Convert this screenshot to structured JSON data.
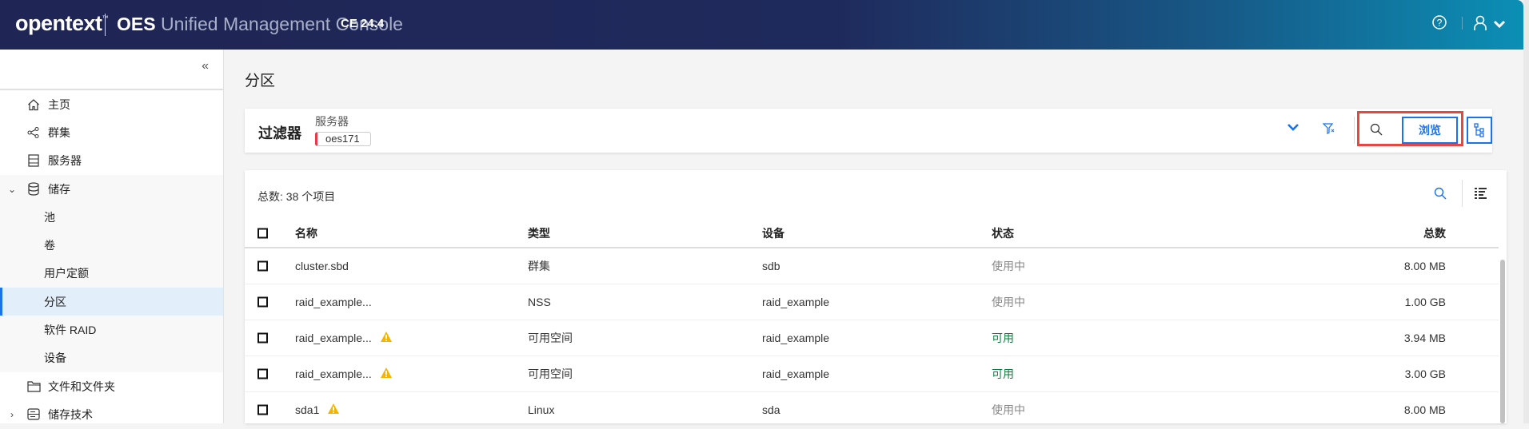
{
  "header": {
    "logo": "opentext",
    "logo_tm": "™",
    "product": "OES",
    "app": "Unified Management Console",
    "version": "CE 24.4"
  },
  "sidebar": {
    "collapse": "«",
    "items": [
      {
        "label": "主页",
        "icon": "home-icon"
      },
      {
        "label": "群集",
        "icon": "share-icon"
      },
      {
        "label": "服务器",
        "icon": "server-icon"
      },
      {
        "label": "储存",
        "icon": "database-icon",
        "expanded": true
      },
      {
        "label": "池"
      },
      {
        "label": "卷"
      },
      {
        "label": "用户定额"
      },
      {
        "label": "分区",
        "active": true
      },
      {
        "label": "软件 RAID"
      },
      {
        "label": "设备"
      },
      {
        "label": "文件和文件夹",
        "icon": "folder-icon"
      },
      {
        "label": "储存技术",
        "icon": "storage-icon"
      }
    ]
  },
  "page": {
    "title": "分区"
  },
  "filter": {
    "title": "过滤器",
    "server_label": "服务器",
    "server_value": "oes171",
    "browse": "浏览"
  },
  "table": {
    "total": "总数: 38 个项目",
    "columns": [
      "名称",
      "类型",
      "设备",
      "状态",
      "总数"
    ],
    "rows": [
      {
        "name": "cluster.sbd",
        "warn": false,
        "type": "群集",
        "device": "sdb",
        "status": "使用中",
        "total": "8.00 MB"
      },
      {
        "name": "raid_example...",
        "warn": false,
        "type": "NSS",
        "device": "raid_example",
        "status": "使用中",
        "total": "1.00 GB"
      },
      {
        "name": "raid_example...",
        "warn": true,
        "type": "可用空间",
        "device": "raid_example",
        "status": "可用",
        "total": "3.94 MB"
      },
      {
        "name": "raid_example...",
        "warn": true,
        "type": "可用空间",
        "device": "raid_example",
        "status": "可用",
        "total": "3.00 GB"
      },
      {
        "name": "sda1",
        "warn": true,
        "type": "Linux",
        "device": "sda",
        "status": "使用中",
        "total": "8.00 MB"
      }
    ]
  },
  "colors": {
    "accent": "#1a73e8",
    "available": "#0a7d3c",
    "inuse": "#888888",
    "highlight": "#e8473f"
  }
}
